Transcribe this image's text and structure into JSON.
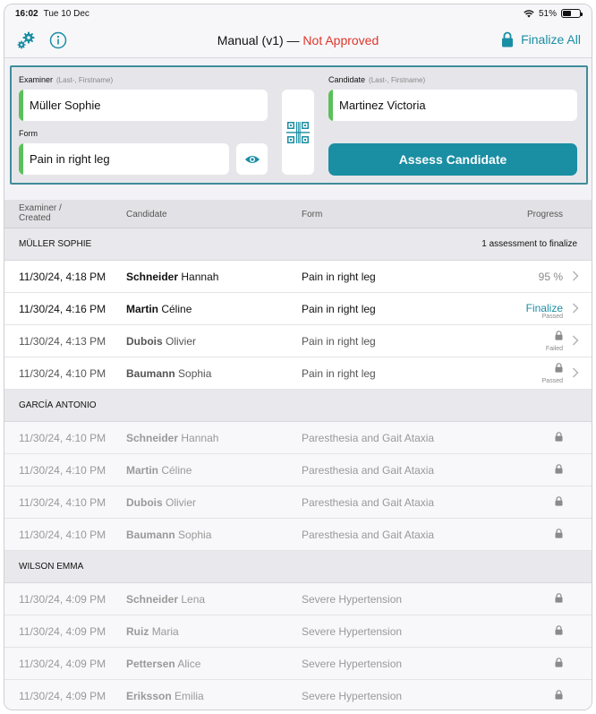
{
  "status_bar": {
    "time": "16:02",
    "date": "Tue 10 Dec",
    "battery": "51%"
  },
  "nav": {
    "title_prefix": "Manual (v1) —",
    "title_status": "Not Approved",
    "finalize_all_label": "Finalize All",
    "status_color": "#e0352b",
    "accent_color": "#1a8ea3"
  },
  "form_panel": {
    "examiner_label": "Examiner",
    "examiner_hint": "(Last-, Firstname)",
    "examiner_last": "Müller",
    "examiner_first": "Sophie",
    "candidate_label": "Candidate",
    "candidate_hint": "(Last-, Firstname)",
    "candidate_last": "Martinez",
    "candidate_first": "Victoria",
    "form_label": "Form",
    "form_value": "Pain in right leg",
    "assess_label": "Assess Candidate"
  },
  "table_header": {
    "col_examiner_line1": "Examiner /",
    "col_examiner_line2": "Created",
    "col_candidate": "Candidate",
    "col_form": "Form",
    "col_progress": "Progress"
  },
  "groups": [
    {
      "last": "MÜLLER",
      "first": "SOPHIE",
      "count": "1 assessment to finalize",
      "rows": [
        {
          "date": "11/30/24, 4:18 PM",
          "last": "Schneider",
          "first": "Hannah",
          "form": "Pain in right leg",
          "progress": "95 %",
          "sub": ""
        },
        {
          "date": "11/30/24, 4:16 PM",
          "last": "Martin",
          "first": "Céline",
          "form": "Pain in right leg",
          "progress": "Finalize",
          "sub": "Passed"
        },
        {
          "date": "11/30/24, 4:13 PM",
          "last": "Dubois",
          "first": "Olivier",
          "form": "Pain in right leg",
          "progress": "",
          "sub": "Failed"
        },
        {
          "date": "11/30/24, 4:10 PM",
          "last": "Baumann",
          "first": "Sophia",
          "form": "Pain in right leg",
          "progress": "",
          "sub": "Passed"
        }
      ]
    },
    {
      "last": "GARCÍA",
      "first": "ANTONIO",
      "count": "",
      "rows": [
        {
          "date": "11/30/24, 4:10 PM",
          "last": "Schneider",
          "first": "Hannah",
          "form": "Paresthesia and Gait Ataxia"
        },
        {
          "date": "11/30/24, 4:10 PM",
          "last": "Martin",
          "first": "Céline",
          "form": "Paresthesia and Gait Ataxia"
        },
        {
          "date": "11/30/24, 4:10 PM",
          "last": "Dubois",
          "first": "Olivier",
          "form": "Paresthesia and Gait Ataxia"
        },
        {
          "date": "11/30/24, 4:10 PM",
          "last": "Baumann",
          "first": "Sophia",
          "form": "Paresthesia and Gait Ataxia"
        }
      ]
    },
    {
      "last": "WILSON",
      "first": "EMMA",
      "count": "",
      "rows": [
        {
          "date": "11/30/24, 4:09 PM",
          "last": "Schneider",
          "first": "Lena",
          "form": "Severe Hypertension"
        },
        {
          "date": "11/30/24, 4:09 PM",
          "last": "Ruiz",
          "first": "Maria",
          "form": "Severe Hypertension"
        },
        {
          "date": "11/30/24, 4:09 PM",
          "last": "Pettersen",
          "first": "Alice",
          "form": "Severe Hypertension"
        },
        {
          "date": "11/30/24, 4:09 PM",
          "last": "Eriksson",
          "first": "Emilia",
          "form": "Severe Hypertension"
        }
      ]
    }
  ]
}
